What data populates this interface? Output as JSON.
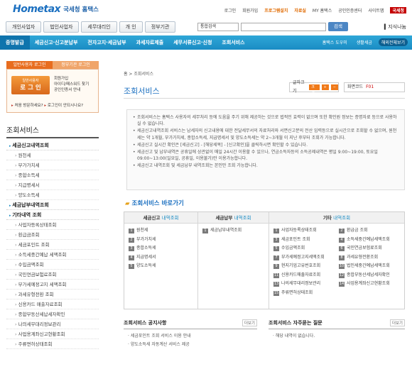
{
  "brand": {
    "logo_mark": "Hometax",
    "logo_text": "국세청 홈택스"
  },
  "util": [
    "로그인",
    "회원가입",
    "프로그램설치",
    "자료실",
    "MY 홈택스",
    "공인인증센터",
    "사이트맵"
  ],
  "util_nts": "국세청",
  "tabs": [
    "개인사업자",
    "법인사업자",
    "세무대리인",
    "개 인",
    "정부기관"
  ],
  "search": {
    "select": "통합검색",
    "button": "검색"
  },
  "knowledge": "지식나눔",
  "mainnav": [
    "증명발급",
    "세금신고·신고분납부",
    "전자고지·세금납부",
    "과세자료제출",
    "세무서류신고·신청",
    "조회서비스"
  ],
  "navright": [
    "홈택스 도우미",
    "생활세금",
    "해외전체보기"
  ],
  "login": {
    "tab_on": "일반사용자 로그인",
    "tab_off": "정부기관 로그인",
    "button_small": "일반사용자",
    "button_big": "로 그 인",
    "links": [
      "회원가입",
      "아이디/패스워드 찾기",
      "공인인증서 안내"
    ],
    "foot_a": "처음 방문하세요?",
    "foot_b": "로그인이 안되시나요?"
  },
  "sidebar": {
    "title": "조회서비스",
    "menu": [
      {
        "type": "h",
        "label": "세금신고내역조회"
      },
      {
        "type": "i",
        "label": "원천세"
      },
      {
        "type": "i",
        "label": "부가가치세"
      },
      {
        "type": "i",
        "label": "종합소득세"
      },
      {
        "type": "i",
        "label": "지급명세서"
      },
      {
        "type": "i",
        "label": "양도소득세"
      },
      {
        "type": "h",
        "label": "세금납부내역조회"
      },
      {
        "type": "h",
        "label": "기타내역 조회"
      },
      {
        "type": "i",
        "label": "사업자등록상태조회"
      },
      {
        "type": "i",
        "label": "환급금조회"
      },
      {
        "type": "i",
        "label": "세금포인트 조회"
      },
      {
        "type": "i",
        "label": "소득세중간예납 세액조회"
      },
      {
        "type": "i",
        "label": "수입금액조회"
      },
      {
        "type": "i",
        "label": "국민연금보험료조회"
      },
      {
        "type": "i",
        "label": "부가세예정고지 세액조회"
      },
      {
        "type": "i",
        "label": "과세유형전환 조회"
      },
      {
        "type": "i",
        "label": "신용카드 매출자료조회"
      },
      {
        "type": "i",
        "label": "종합부동산세납세자확인"
      },
      {
        "type": "i",
        "label": "나의세무대리정보관리"
      },
      {
        "type": "i",
        "label": "사업용계좌신고현황조회"
      },
      {
        "type": "i",
        "label": "주류면허상태조회"
      }
    ]
  },
  "content": {
    "breadcrumb": "홈 > 조회서비스",
    "title": "조회서비스",
    "font_label": "글자크기",
    "font_btn": "크게",
    "menucode_label": "화면코드",
    "menucode_value": "F01",
    "info": [
      "조회서비스는 홈택스 사용자의 세무처리 등에 도움을 주기 위해 제공하는 것으로 법적인 효력이 없으며 또한 확인원 정보는 증명자료 등으로 사용하실 수 없습니다.",
      "세금신고내역조회 서비스는 납세자의 신고내용에 대한 전달세무서의 자료처리와 서면신고분의 전산 입력등으로 실시간으로 조회할 수 없으며, 원천세는 약 1개월, 부가가치세, 종합소득세, 지급명세서 및 양도소득세는 약 2~3개월 이 지난 후부터 조회가 가능합니다.",
      "세금신고 실시간 확인은 [세금신고] - [해당세목] - [신고확인]을 클릭하시면 확인할 수 있습니다.",
      "세금신고 및 납부내역은 공휴일에 상관없이 매일 24시간 이용할 수 있으나, 연금소득자등의 소득공제내역은 평일 9:00~19:00, 토요일 09:00~13:00(일요일, 공휴일, 이용불가)만 이용가능합니다.",
      "세금신고 내역조회 및 세금납부 내역조회는 본인만 조회 가능합니다."
    ],
    "shortcut_title": "조회서비스 바로가기",
    "grid": {
      "col1_head": "세금신고",
      "col1_sub": "내역조회",
      "col1": [
        "원천세",
        "부가가치세",
        "종합소득세",
        "지급명세서",
        "양도소득세"
      ],
      "col2_head": "세금납부",
      "col2_sub": "내역조회",
      "col2": [
        "세금납부내역조회"
      ],
      "col3_head": "기타",
      "col3_sub": "내역조회",
      "col3a": [
        "사업자등록상태조회",
        "세금포인트 조회",
        "수입금액조회",
        "부가세예정고지세액조회",
        "현지기업고유번호조회",
        "신용카드매출자료조회",
        "나의세무대리정보관리",
        "주류면허상태조회"
      ],
      "col3b": [
        "환급금 조회",
        "소득세중간예납세액조회",
        "국민연금보험료조회",
        "과세유형전환조회",
        "법인세중간예납세액조회",
        "종합부동산세납세자확인",
        "사업용계좌신고현황조회"
      ]
    },
    "notice1": {
      "title": "조회서비스 공지사항",
      "more": "더보기",
      "items": [
        "세금포인트 조회 서비스 이용 안내",
        "양도소득세 자동계산 서비스 제공"
      ]
    },
    "notice2": {
      "title": "조회서비스 자주묻는 질문",
      "more": "더보기",
      "items": [
        "해당 내역이 없습니다."
      ]
    }
  }
}
